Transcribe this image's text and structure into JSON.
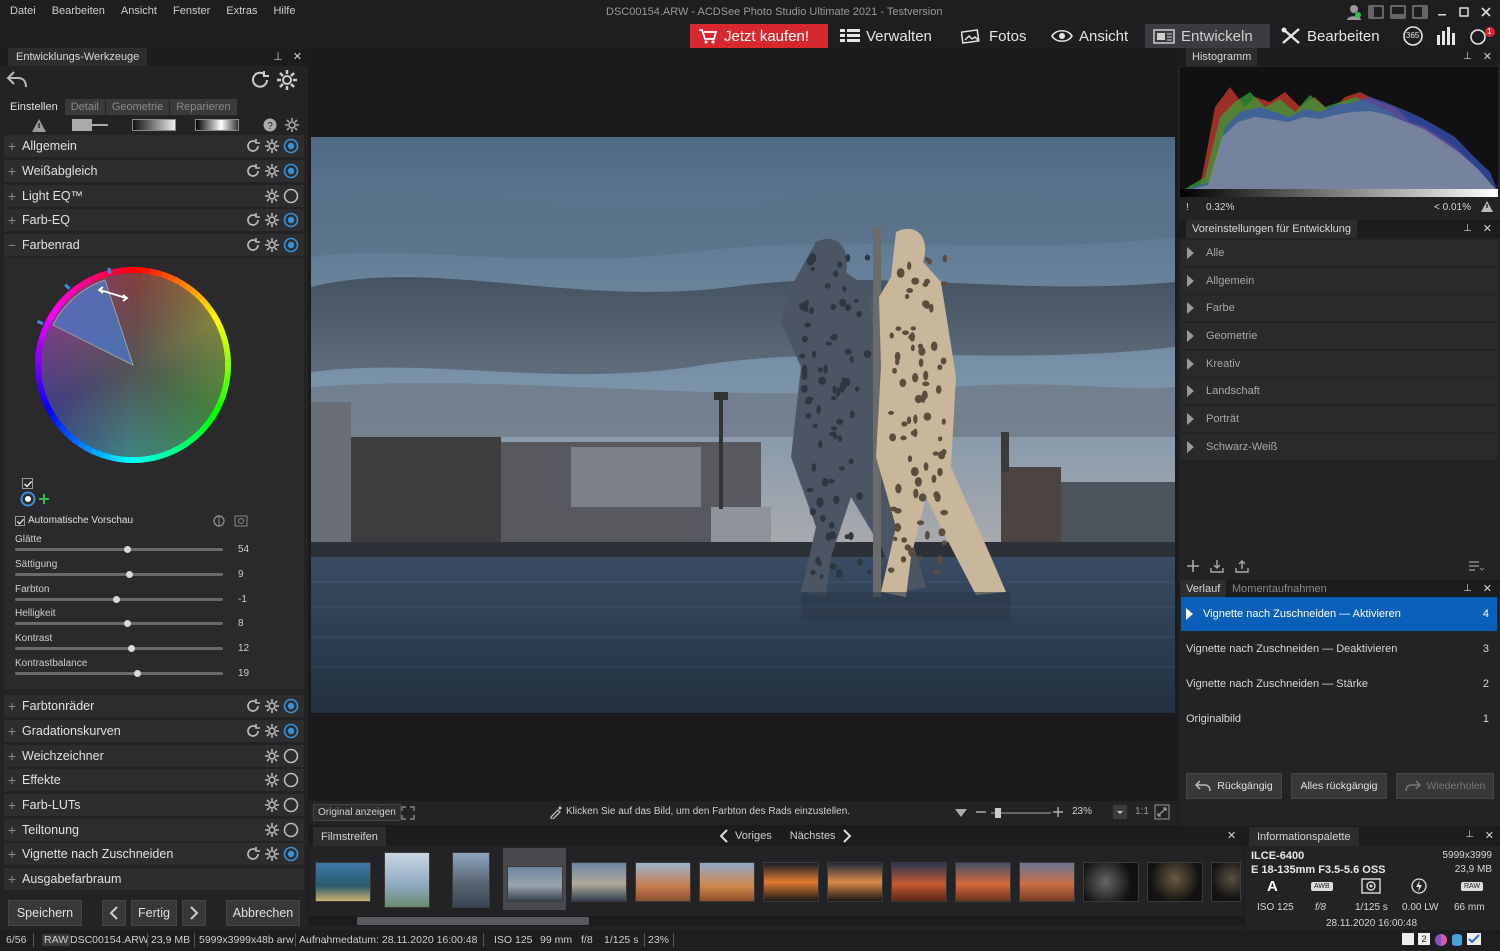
{
  "menu": [
    "Datei",
    "Bearbeiten",
    "Ansicht",
    "Fenster",
    "Extras",
    "Hilfe"
  ],
  "window_title": "DSC00154.ARW - ACDSee Photo Studio Ultimate 2021 - Testversion",
  "modes": {
    "buy": "Jetzt kaufen!",
    "manage": "Verwalten",
    "photos": "Fotos",
    "view": "Ansicht",
    "develop": "Entwickeln",
    "edit": "Bearbeiten",
    "badge_365": "365",
    "notif_count": "1"
  },
  "left_panel": {
    "title": "Entwicklungs-Werkzeuge",
    "tabs": [
      "Einstellen",
      "Detail",
      "Geometrie",
      "Reparieren"
    ],
    "sections_top": [
      "Allgemein",
      "Weißabgleich",
      "Light EQ™",
      "Farb-EQ",
      "Farbenrad"
    ],
    "auto_preview": "Automatische Vorschau",
    "sliders": [
      {
        "label": "Glätte",
        "value": "54",
        "pct": 54
      },
      {
        "label": "Sättigung",
        "value": "9",
        "pct": 55
      },
      {
        "label": "Farbton",
        "value": "-1",
        "pct": 49
      },
      {
        "label": "Helligkeit",
        "value": "8",
        "pct": 54
      },
      {
        "label": "Kontrast",
        "value": "12",
        "pct": 56
      },
      {
        "label": "Kontrastbalance",
        "value": "19",
        "pct": 59
      }
    ],
    "sections_bottom": [
      "Farbtonräder",
      "Gradationskurven",
      "Weichzeichner",
      "Effekte",
      "Farb-LUTs",
      "Teiltonung",
      "Vignette nach Zuschneiden",
      "Ausgabefarbraum"
    ],
    "buttons": {
      "save": "Speichern",
      "done": "Fertig",
      "cancel": "Abbrechen"
    }
  },
  "viewer": {
    "show_original": "Original anzeigen",
    "hint": "Klicken Sie auf das Bild, um den Farbton des Rads einzustellen.",
    "zoom": "23%",
    "one_to_one": "1:1"
  },
  "histogram": {
    "title": "Histogramm",
    "left_clip": "0.32%",
    "right_clip": "< 0.01%"
  },
  "presets": {
    "title": "Voreinstellungen für Entwicklung",
    "items": [
      "Alle",
      "Allgemein",
      "Farbe",
      "Geometrie",
      "Kreativ",
      "Landschaft",
      "Porträt",
      "Schwarz-Weiß"
    ]
  },
  "history": {
    "tabs": [
      "Verlauf",
      "Momentaufnahmen"
    ],
    "items": [
      {
        "label": "Vignette nach Zuschneiden — Aktivieren",
        "num": "4"
      },
      {
        "label": "Vignette nach Zuschneiden — Deaktivieren",
        "num": "3"
      },
      {
        "label": "Vignette nach Zuschneiden — Stärke",
        "num": "2"
      },
      {
        "label": "Originalbild",
        "num": "1"
      }
    ],
    "buttons": {
      "undo": "Rückgängig",
      "undo_all": "Alles rückgängig",
      "redo": "Wiederholen"
    }
  },
  "filmstrip": {
    "title": "Filmstreifen",
    "prev": "Voriges",
    "next": "Nächstes"
  },
  "info": {
    "title": "Informationspalette",
    "camera": "ILCE-6400",
    "dimensions": "5999x3999",
    "lens": "E 18-135mm F3.5-5.6 OSS",
    "size": "23,9 MB",
    "mode": "A",
    "awb": "AWB",
    "raw": "RAW",
    "iso": "ISO 125",
    "aperture": "f/8",
    "shutter": "1/125 s",
    "ev": "0.00 LW",
    "focal": "66 mm",
    "date": "28.11.2020 16:00:48"
  },
  "status": {
    "index": "6/56",
    "format": "RAW",
    "filename": "DSC00154.ARW",
    "size": "23,9 MB",
    "dims": "5999x3999x48b arw",
    "date": "Aufnahmedatum: 28.11.2020 16:00:48",
    "iso": "ISO 125",
    "focal": "99 mm",
    "aperture": "f/8",
    "shutter": "1/125 s",
    "zoom": "23%",
    "page_num": "2"
  },
  "colors": {
    "accent": "#0a5fb8",
    "buy": "#d7282f",
    "panel": "#232326"
  }
}
